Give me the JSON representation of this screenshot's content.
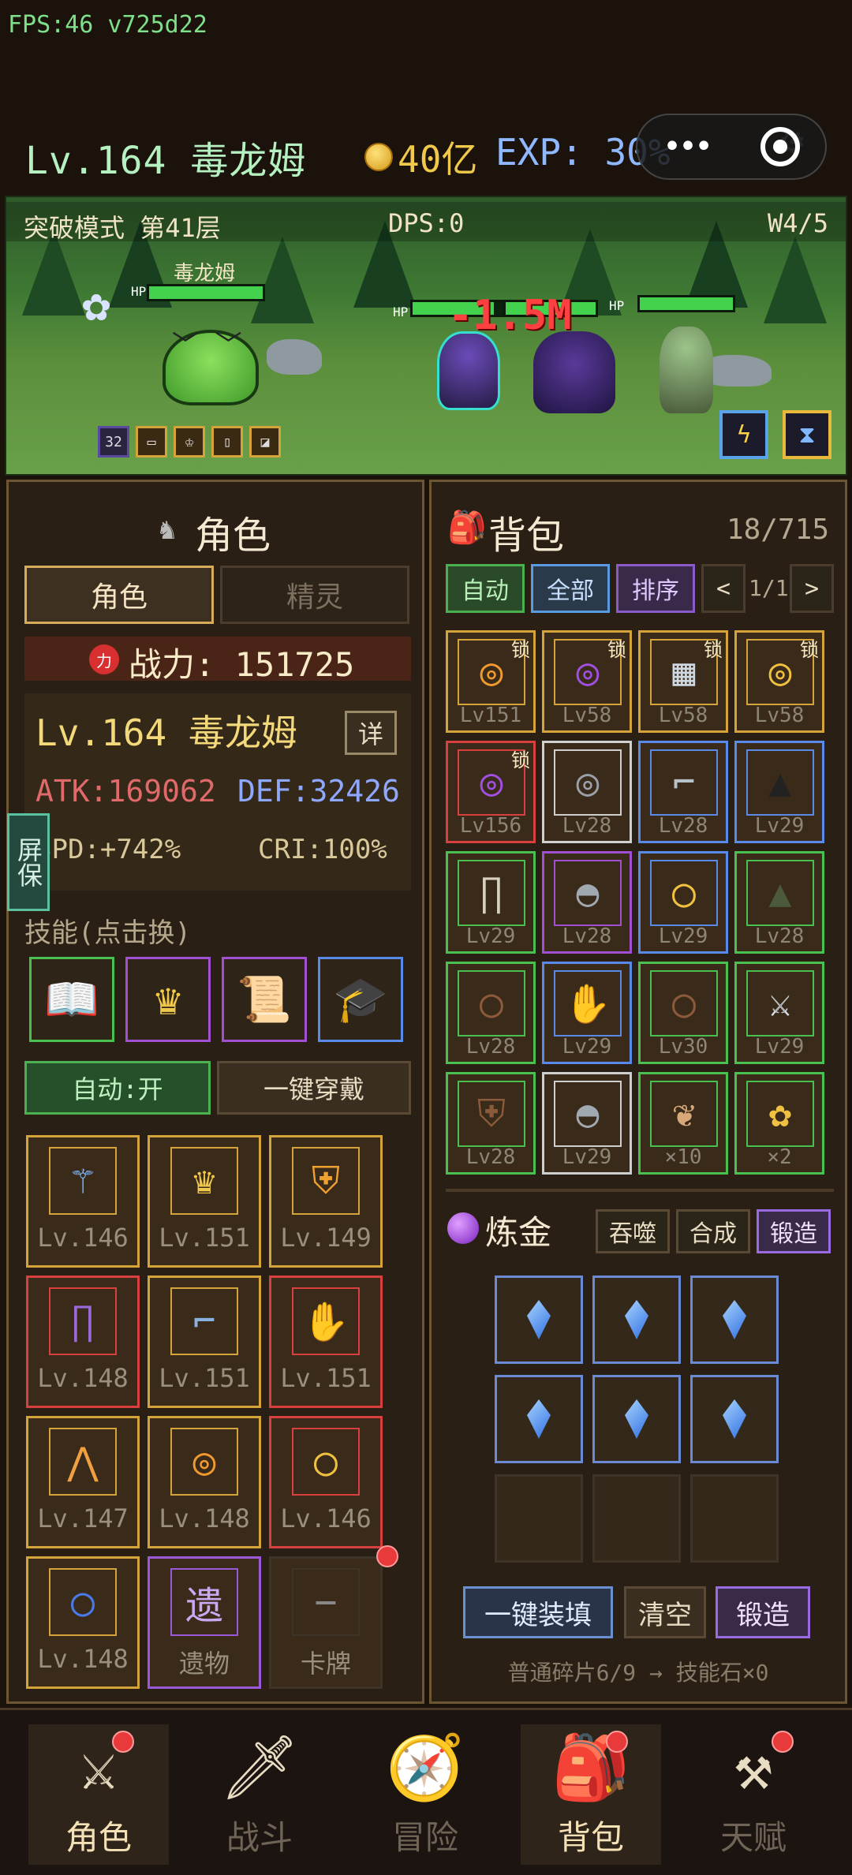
{
  "debug": {
    "fps": "FPS:46 v725d22"
  },
  "header": {
    "level_name": "Lv.164 毒龙姆",
    "gold": "40亿",
    "exp": "EXP: 30%"
  },
  "battle": {
    "mode": "突破模式 第41层",
    "dps": "DPS:0",
    "wave": "W4/5",
    "player_name": "毒龙姆",
    "hp_label": "HP",
    "damage": "-1.5M",
    "skill_count": "32",
    "player_hp": 1.0,
    "enemy1_hp": 0.9,
    "enemy2_hp": 1.0
  },
  "character": {
    "title": "角色",
    "tabs": [
      "角色",
      "精灵"
    ],
    "power_label": "战力: 151725",
    "power_icon": "力",
    "level_name": "Lv.164 毒龙姆",
    "detail": "详",
    "atk": "ATK:169062",
    "def": "DEF:32426",
    "spd": "SPD:+742%",
    "cri": "CRI:100%",
    "screensaver": "屏保",
    "skills_label": "技能(点击换)",
    "auto_btn": "自动:开",
    "equip_all_btn": "一键穿戴",
    "equipment": [
      {
        "icon": "staff",
        "lv": "Lv.146"
      },
      {
        "icon": "crown",
        "lv": "Lv.151"
      },
      {
        "icon": "armor",
        "lv": "Lv.149"
      },
      {
        "icon": "pants",
        "lv": "Lv.148"
      },
      {
        "icon": "boots",
        "lv": "Lv.151"
      },
      {
        "icon": "gloves",
        "lv": "Lv.151"
      },
      {
        "icon": "wings",
        "lv": "Lv.147"
      },
      {
        "icon": "necklace",
        "lv": "Lv.148"
      },
      {
        "icon": "ring",
        "lv": "Lv.146"
      },
      {
        "icon": "ring-blue",
        "lv": "Lv.148"
      },
      {
        "icon": "relic",
        "lv": "遗物",
        "glyph": "遗"
      },
      {
        "icon": "card",
        "lv": "卡牌",
        "glyph": "−"
      }
    ]
  },
  "bag": {
    "title": "背包",
    "count": "18/715",
    "buttons": {
      "auto": "自动",
      "all": "全部",
      "sort": "排序",
      "page": "1/1",
      "prev": "<",
      "next": ">"
    },
    "lock": "锁",
    "items": [
      {
        "lv": "Lv151",
        "locked": true
      },
      {
        "lv": "Lv58",
        "locked": true
      },
      {
        "lv": "Lv58",
        "locked": true
      },
      {
        "lv": "Lv58",
        "locked": true
      },
      {
        "lv": "Lv156",
        "locked": true
      },
      {
        "lv": "Lv28",
        "locked": false
      },
      {
        "lv": "Lv28",
        "locked": false
      },
      {
        "lv": "Lv29",
        "locked": false
      },
      {
        "lv": "Lv29",
        "locked": false
      },
      {
        "lv": "Lv28",
        "locked": false
      },
      {
        "lv": "Lv29",
        "locked": false
      },
      {
        "lv": "Lv28",
        "locked": false
      },
      {
        "lv": "Lv28",
        "locked": false
      },
      {
        "lv": "Lv29",
        "locked": false
      },
      {
        "lv": "Lv30",
        "locked": false
      },
      {
        "lv": "Lv29",
        "locked": false
      },
      {
        "lv": "Lv28",
        "locked": false
      },
      {
        "lv": "Lv29",
        "locked": false
      },
      {
        "lv": "×10",
        "locked": false
      },
      {
        "lv": "×2",
        "locked": false
      }
    ]
  },
  "alchemy": {
    "title": "炼金",
    "tabs": [
      "吞噬",
      "合成",
      "锻造"
    ],
    "fill_btn": "一键装填",
    "clear_btn": "清空",
    "forge_btn": "锻造",
    "info": "普通碎片6/9 → 技能石×0"
  },
  "nav": [
    {
      "label": "角色",
      "icon": "⚔"
    },
    {
      "label": "战斗",
      "icon": "🗡"
    },
    {
      "label": "冒险",
      "icon": "🧭"
    },
    {
      "label": "背包",
      "icon": "🎒"
    },
    {
      "label": "天赋",
      "icon": "⚒"
    }
  ]
}
